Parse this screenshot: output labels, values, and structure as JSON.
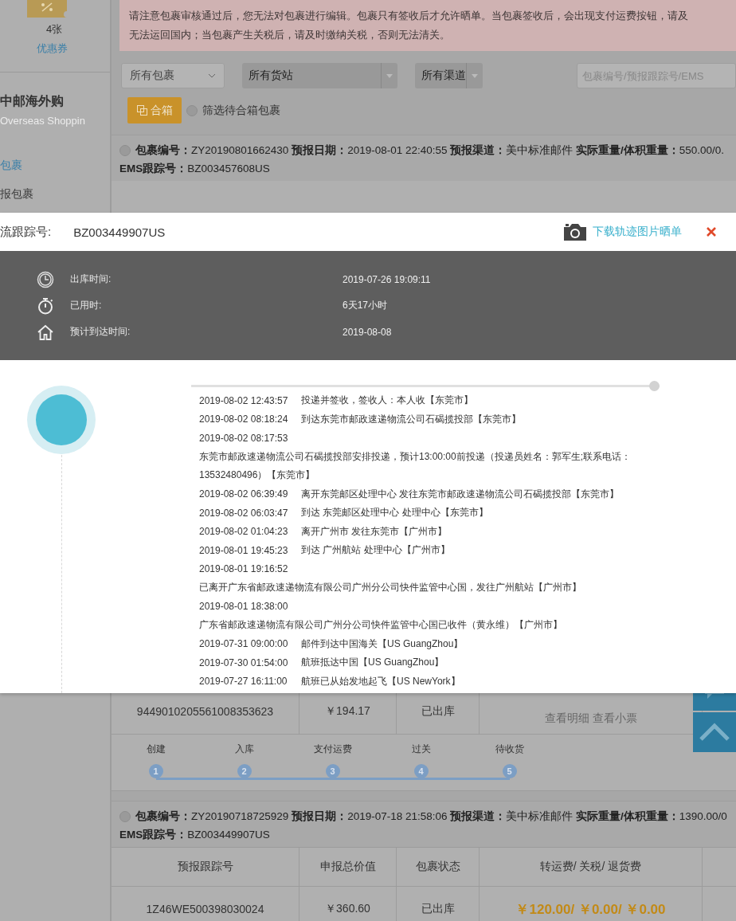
{
  "sidebar": {
    "coupon_count": "4张",
    "coupon_label": "优惠券",
    "brand": "中邮海外购",
    "brand_en": "Overseas Shoppin",
    "nav": [
      {
        "label": "包裹",
        "selected": true
      },
      {
        "label": "报包裹",
        "selected": false
      }
    ]
  },
  "notice": [
    "请注意包裹审核通过后，您无法对包裹进行编辑。包裹只有签收后才允许晒单。当包裹签收后，会出现支付运费按钮，请及",
    "无法运回国内；当包裹产生关税后，请及时缴纳关税，否则无法清关。"
  ],
  "filters": {
    "selects": [
      {
        "value": "所有包裹",
        "kind": "plain"
      },
      {
        "value": "所有货站",
        "kind": "shaded"
      },
      {
        "value": "所有渠道",
        "kind": "shaded"
      }
    ],
    "search": {
      "placeholder": "包裹编号/预报跟踪号/EMS"
    },
    "merge_button": "合箱",
    "merge_filter": {
      "label": "筛选待合箱包裹",
      "checked": false
    }
  },
  "packages": [
    {
      "checked": false,
      "header": "**包裹编号：**ZY20190801662430 **预报日期：**2019-08-01 22:40:55 **预报渠道：**美中标准邮件 **实际重量/体积重量：**550.00/0.",
      "ems": "**EMS跟踪号：**BZ003457608US",
      "row": {
        "tracking": "9449010205561008353623",
        "value": "￥194.17",
        "status": "已出库",
        "links": [
          "查看明细",
          "查看小票"
        ]
      },
      "steps": [
        {
          "label": "创建",
          "number": "1"
        },
        {
          "label": "入库",
          "number": "2"
        },
        {
          "label": "支付运费",
          "number": "3"
        },
        {
          "label": "过关",
          "number": "4"
        },
        {
          "label": "待收货",
          "number": "5"
        }
      ]
    },
    {
      "checked": false,
      "header": "**包裹编号：**ZY20190718725929 **预报日期：**2019-07-18 21:58:06 **预报渠道：**美中标准邮件 **实际重量/体积重量：**1390.00/0",
      "ems": "**EMS跟踪号：**BZ003449907US",
      "columns": [
        "预报跟踪号",
        "申报总价值",
        "包裹状态",
        "转运费/ 关税/ 退货费"
      ],
      "row": {
        "tracking": "1Z46WE500398030024",
        "value": "￥360.60",
        "status": "已出库",
        "fees": "￥120.00/ ￥0.00/ ￥0.00"
      }
    }
  ],
  "modal": {
    "progress": {
      "level": 1
    },
    "tracking_label": "流跟踪号:",
    "tracking_number": "BZ003449907US",
    "download_link": "下载轨迹图片晒单",
    "summary": [
      {
        "kind": "clock",
        "label": "出库时间:",
        "value": "2019-07-26 19:09:11"
      },
      {
        "kind": "stopwatch",
        "label": "已用时:",
        "value": "6天17小时"
      },
      {
        "kind": "home",
        "label": "预计到达时间:",
        "value": "2019-08-08"
      }
    ],
    "events": [
      {
        "kind": "inline",
        "time": "2019-08-02 12:43:57",
        "text": "投递并签收，签收人：本人收【东莞市】"
      },
      {
        "kind": "inline",
        "time": "2019-08-02 08:18:24",
        "text": "到达东莞市邮政速递物流公司石碣揽投部【东莞市】"
      },
      {
        "kind": "wrapped",
        "time": "2019-08-02 08:17:53",
        "text": "东莞市邮政速递物流公司石碣揽投部安排投递，预计13:00:00前投递（投递员姓名：郭军生;联系电话：13532480496）【东莞市】"
      },
      {
        "kind": "inline",
        "time": "2019-08-02 06:39:49",
        "text": "离开东莞邮区处理中心 发往东莞市邮政速递物流公司石碣揽投部【东莞市】"
      },
      {
        "kind": "inline",
        "time": "2019-08-02 06:03:47",
        "text": "到达 东莞邮区处理中心 处理中心【东莞市】"
      },
      {
        "kind": "inline",
        "time": "2019-08-02 01:04:23",
        "text": "离开广州市 发往东莞市【广州市】"
      },
      {
        "kind": "inline",
        "time": "2019-08-01 19:45:23",
        "text": "到达 广州航站 处理中心【广州市】"
      },
      {
        "kind": "wrapped",
        "time": "2019-08-01 19:16:52",
        "text": "已离开广东省邮政速递物流有限公司广州分公司快件监管中心国，发往广州航站【广州市】"
      },
      {
        "kind": "wrapped",
        "time": "2019-08-01 18:38:00",
        "text": "广东省邮政速递物流有限公司广州分公司快件监管中心国已收件（黄永维）【广州市】"
      },
      {
        "kind": "inline",
        "time": "2019-07-31 09:00:00",
        "text": "邮件到达中国海关【US GuangZhou】"
      },
      {
        "kind": "inline",
        "time": "2019-07-30 01:54:00",
        "text": "航班抵达中国【US GuangZhou】"
      },
      {
        "kind": "inline",
        "time": "2019-07-27 16:11:00",
        "text": "航班已从始发地起飞【US NewYork】"
      }
    ]
  }
}
